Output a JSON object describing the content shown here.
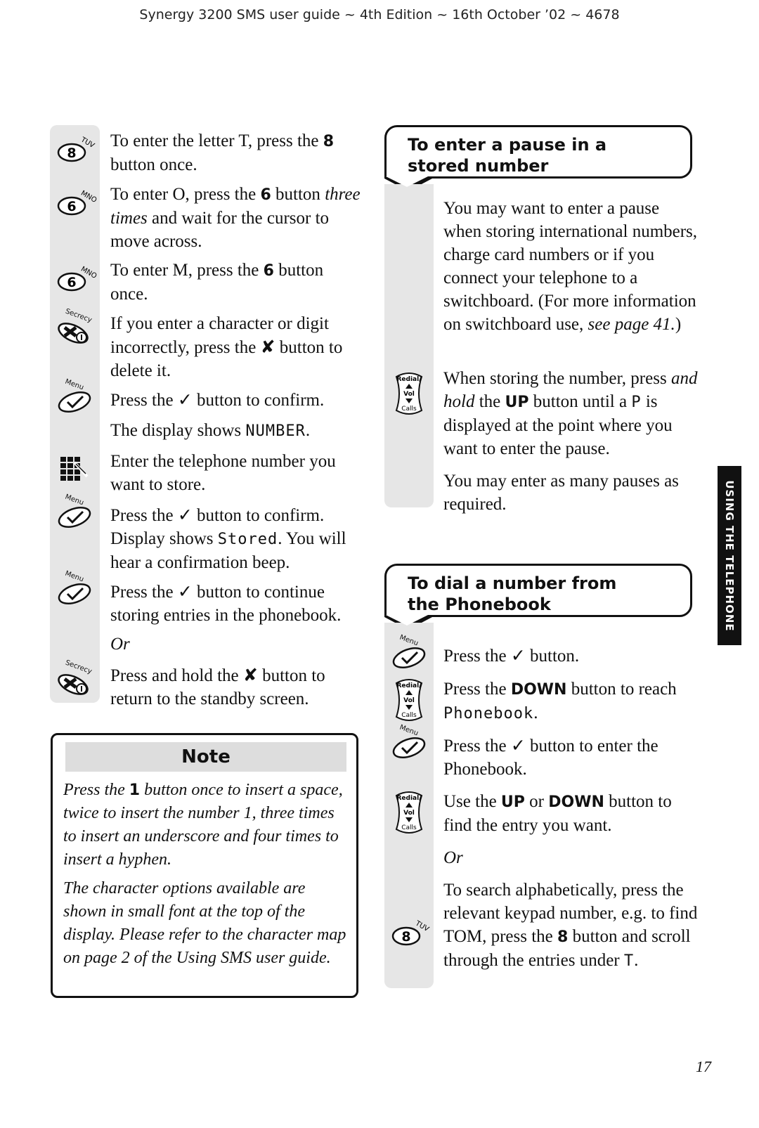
{
  "header": "Synergy 3200 SMS user guide ~ 4th Edition ~ 16th October ’02 ~ 4678",
  "left_steps": [
    {
      "icon": "key-8-tuv-icon",
      "label": "8",
      "sub": "TUV",
      "segs": [
        {
          "t": "To enter the letter T, press the "
        },
        {
          "t": "8",
          "s": "b"
        },
        {
          "t": " button once."
        }
      ]
    },
    {
      "icon": "key-6-mno-icon",
      "label": "6",
      "sub": "MNO",
      "segs": [
        {
          "t": "To enter O, press the "
        },
        {
          "t": "6",
          "s": "b"
        },
        {
          "t": " button "
        },
        {
          "t": "three times",
          "s": "i"
        },
        {
          "t": " and wait for the cursor to move across."
        }
      ]
    },
    {
      "icon": "key-6-mno-icon",
      "label": "6",
      "sub": "MNO",
      "segs": [
        {
          "t": "To enter M, press the "
        },
        {
          "t": "6",
          "s": "b"
        },
        {
          "t": " button once."
        }
      ]
    },
    {
      "icon": "secrecy-delete-icon",
      "sub": "Secrecy",
      "segs": [
        {
          "t": "If you enter a character or digit incorrectly, press the "
        },
        {
          "t": "✘",
          "s": "sym"
        },
        {
          "t": " button to delete it."
        }
      ]
    },
    {
      "icon": "menu-confirm-icon",
      "sub": "Menu",
      "segs": [
        {
          "t": "Press the "
        },
        {
          "t": "✓",
          "s": "sym"
        },
        {
          "t": " button to confirm."
        }
      ]
    },
    {
      "segs": [
        {
          "t": "The display shows "
        },
        {
          "t": "NUMBER",
          "s": "lcd"
        },
        {
          "t": "."
        }
      ]
    },
    {
      "icon": "keypad-icon",
      "segs": [
        {
          "t": "Enter the telephone number you want to store."
        }
      ]
    },
    {
      "icon": "menu-confirm-icon",
      "sub": "Menu",
      "segs": [
        {
          "t": "Press the "
        },
        {
          "t": "✓",
          "s": "sym"
        },
        {
          "t": " button to confirm. Display shows "
        },
        {
          "t": "Stored",
          "s": "lcd"
        },
        {
          "t": ". You will hear a confirmation beep."
        }
      ]
    },
    {
      "icon": "menu-confirm-icon",
      "sub": "Menu",
      "segs": [
        {
          "t": "Press the "
        },
        {
          "t": "✓",
          "s": "sym"
        },
        {
          "t": " button to continue storing entries in the phonebook."
        }
      ]
    },
    {
      "segs": [
        {
          "t": "Or",
          "s": "i"
        }
      ]
    },
    {
      "icon": "secrecy-delete-icon",
      "sub": "Secrecy",
      "segs": [
        {
          "t": "Press and hold the "
        },
        {
          "t": "✘",
          "s": "sym"
        },
        {
          "t": " button to return to the standby screen."
        }
      ]
    }
  ],
  "note": {
    "title": "Note",
    "paras": [
      [
        {
          "t": "Press the "
        },
        {
          "t": "1",
          "s": "b"
        },
        {
          "t": " button once to insert a space, twice to insert the number 1, three times to insert an underscore and four times to insert a hyphen."
        }
      ],
      [
        {
          "t": "The character options available are shown in small font at the top of the display. Please refer to the character map on page 2 of the Using SMS user guide."
        }
      ]
    ]
  },
  "pause_section": {
    "title": "To enter a pause in a stored number",
    "steps": [
      {
        "segs": [
          {
            "t": "You may want to enter a pause when storing international numbers, charge card numbers or if you connect your telephone to a switchboard. (For more information on switchboard use, "
          },
          {
            "t": "see page 41.",
            "s": "i"
          },
          {
            "t": ")"
          }
        ]
      },
      {
        "icon": "redial-vol-calls-icon",
        "segs": [
          {
            "t": "When storing the number, press "
          },
          {
            "t": "and hold",
            "s": "i"
          },
          {
            "t": " the "
          },
          {
            "t": "UP",
            "s": "b"
          },
          {
            "t": " button until a "
          },
          {
            "t": "P",
            "s": "lcd"
          },
          {
            "t": " is displayed at the point where you want to enter the pause."
          }
        ]
      },
      {
        "segs": [
          {
            "t": "You may enter as many pauses as required."
          }
        ]
      }
    ]
  },
  "dial_section": {
    "title": "To dial a number from the Phonebook",
    "steps": [
      {
        "icon": "menu-confirm-icon",
        "sub": "Menu",
        "segs": [
          {
            "t": "Press the "
          },
          {
            "t": "✓",
            "s": "sym"
          },
          {
            "t": " button."
          }
        ]
      },
      {
        "icon": "redial-vol-calls-icon",
        "segs": [
          {
            "t": "Press the "
          },
          {
            "t": "DOWN",
            "s": "b"
          },
          {
            "t": " button to reach "
          },
          {
            "t": "Phonebook",
            "s": "lcd"
          },
          {
            "t": "."
          }
        ]
      },
      {
        "icon": "menu-confirm-icon",
        "sub": "Menu",
        "segs": [
          {
            "t": "Press the "
          },
          {
            "t": "✓",
            "s": "sym"
          },
          {
            "t": " button to enter the Phonebook."
          }
        ]
      },
      {
        "icon": "redial-vol-calls-icon",
        "segs": [
          {
            "t": "Use the "
          },
          {
            "t": "UP",
            "s": "b"
          },
          {
            "t": " or "
          },
          {
            "t": "DOWN",
            "s": "b"
          },
          {
            "t": " button to find the entry you want."
          }
        ]
      },
      {
        "segs": [
          {
            "t": "Or",
            "s": "i"
          }
        ]
      },
      {
        "icon": "key-8-tuv-icon",
        "label": "8",
        "sub": "TUV",
        "segs": [
          {
            "t": "To search alphabetically, press the relevant keypad number, e.g. to find TOM, press the "
          },
          {
            "t": "8",
            "s": "b"
          },
          {
            "t": " button and scroll through the entries under "
          },
          {
            "t": "T",
            "s": "lcd"
          },
          {
            "t": "."
          }
        ]
      }
    ]
  },
  "redial_icon_labels": {
    "top": "Redial/",
    "mid": "Vol",
    "bot": "Calls"
  },
  "side_tab": "USING THE TELEPHONE",
  "page_number": "17"
}
